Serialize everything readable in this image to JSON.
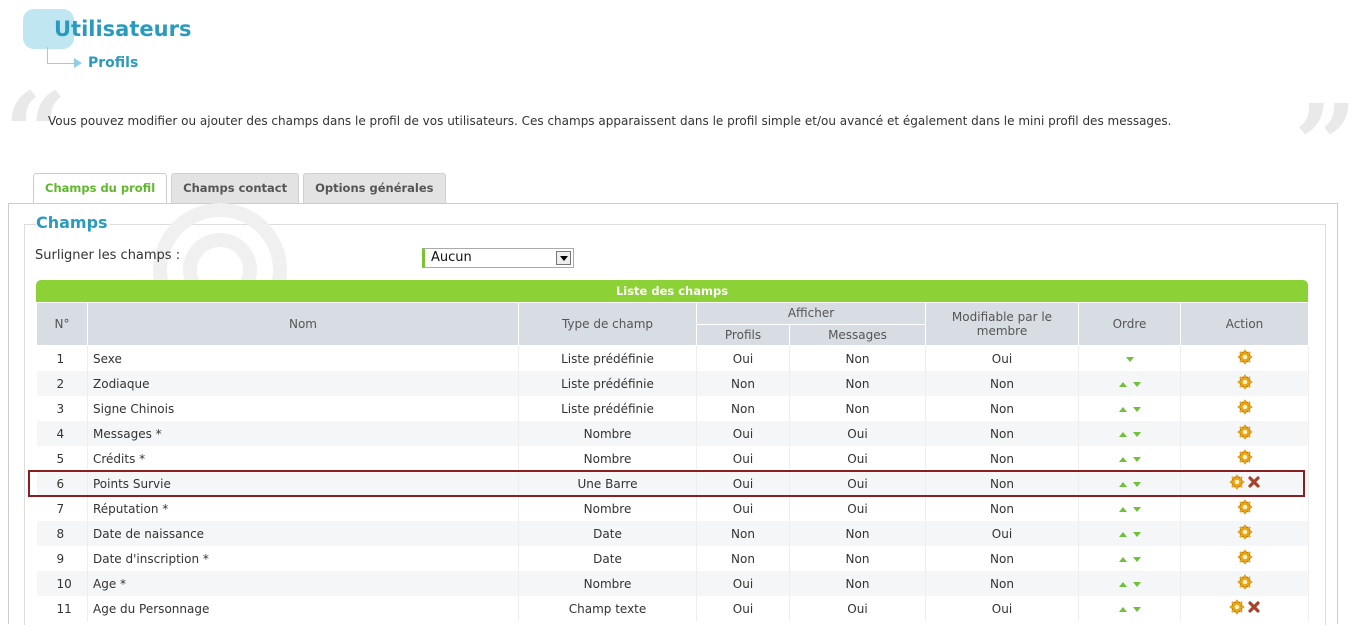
{
  "header": {
    "title": "Utilisateurs",
    "breadcrumb": "Profils",
    "intro": "Vous pouvez modifier ou ajouter des champs dans le profil de vos utilisateurs. Ces champs apparaissent dans le profil simple et/ou avancé et également dans le mini profil des messages."
  },
  "tabs": [
    {
      "label": "Champs du profil",
      "active": true
    },
    {
      "label": "Champs contact",
      "active": false
    },
    {
      "label": "Options générales",
      "active": false
    }
  ],
  "section": {
    "legend": "Champs",
    "highlight_label": "Surligner les champs :",
    "highlight_value": "Aucun"
  },
  "table": {
    "caption": "Liste des champs",
    "headers": {
      "num": "N°",
      "name": "Nom",
      "type": "Type de champ",
      "display": "Afficher",
      "profiles": "Profils",
      "messages": "Messages",
      "editable": "Modifiable par le membre",
      "order": "Ordre",
      "action": "Action"
    },
    "rows": [
      {
        "num": "1",
        "name": "Sexe",
        "type": "Liste prédéfinie",
        "profiles": "Oui",
        "messages": "Non",
        "editable": "Oui",
        "up": false,
        "down": true,
        "deletable": false
      },
      {
        "num": "2",
        "name": "Zodiaque",
        "type": "Liste prédéfinie",
        "profiles": "Non",
        "messages": "Non",
        "editable": "Non",
        "up": true,
        "down": true,
        "deletable": false
      },
      {
        "num": "3",
        "name": "Signe Chinois",
        "type": "Liste prédéfinie",
        "profiles": "Non",
        "messages": "Non",
        "editable": "Non",
        "up": true,
        "down": true,
        "deletable": false
      },
      {
        "num": "4",
        "name": "Messages *",
        "type": "Nombre",
        "profiles": "Oui",
        "messages": "Oui",
        "editable": "Non",
        "up": true,
        "down": true,
        "deletable": false
      },
      {
        "num": "5",
        "name": "Crédits *",
        "type": "Nombre",
        "profiles": "Oui",
        "messages": "Oui",
        "editable": "Non",
        "up": true,
        "down": true,
        "deletable": false
      },
      {
        "num": "6",
        "name": "Points Survie",
        "type": "Une Barre",
        "profiles": "Oui",
        "messages": "Oui",
        "editable": "Non",
        "up": true,
        "down": true,
        "deletable": true,
        "selected": true
      },
      {
        "num": "7",
        "name": "Réputation *",
        "type": "Nombre",
        "profiles": "Oui",
        "messages": "Oui",
        "editable": "Non",
        "up": true,
        "down": true,
        "deletable": false
      },
      {
        "num": "8",
        "name": "Date de naissance",
        "type": "Date",
        "profiles": "Non",
        "messages": "Non",
        "editable": "Oui",
        "up": true,
        "down": true,
        "deletable": false
      },
      {
        "num": "9",
        "name": "Date d'inscription *",
        "type": "Date",
        "profiles": "Non",
        "messages": "Non",
        "editable": "Non",
        "up": true,
        "down": true,
        "deletable": false
      },
      {
        "num": "10",
        "name": "Age *",
        "type": "Nombre",
        "profiles": "Oui",
        "messages": "Non",
        "editable": "Non",
        "up": true,
        "down": true,
        "deletable": false
      },
      {
        "num": "11",
        "name": "Age du Personnage",
        "type": "Champ texte",
        "profiles": "Oui",
        "messages": "Oui",
        "editable": "Oui",
        "up": true,
        "down": true,
        "deletable": true
      }
    ]
  },
  "colors": {
    "accent_blue": "#2a9bbe",
    "accent_green": "#8cd236",
    "selection_border": "#8b1e1e"
  },
  "icons": {
    "edit": "gear-edit-icon",
    "delete": "delete-x-icon",
    "move_up": "arrow-up-icon",
    "move_down": "arrow-down-icon"
  }
}
